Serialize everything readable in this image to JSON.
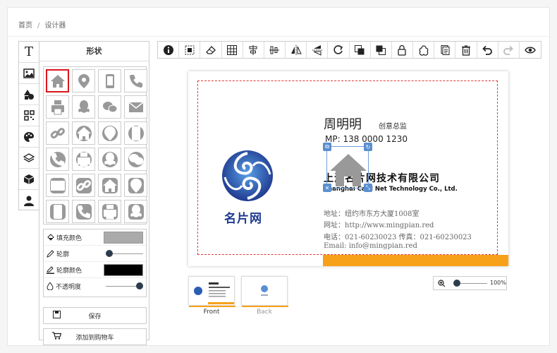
{
  "breadcrumb": {
    "home": "首页",
    "separator": "/",
    "current": "设计器"
  },
  "left_tabs": [
    {
      "icon": "text-icon"
    },
    {
      "icon": "image-icon"
    },
    {
      "icon": "shapes-icon"
    },
    {
      "icon": "qr-code-icon"
    },
    {
      "icon": "palette-icon"
    },
    {
      "icon": "layers-icon"
    },
    {
      "icon": "box-icon"
    },
    {
      "icon": "user-icon"
    }
  ],
  "panel": {
    "title": "形状",
    "shapes": [
      "home-icon",
      "map-pin-icon",
      "tablet-icon",
      "phone-icon",
      "fax-icon",
      "qq-icon",
      "wechat-icon",
      "mail-icon",
      "link-icon",
      "home-circle-icon",
      "map-pin-circle-icon",
      "tablet-circle-icon",
      "phone-circle-icon",
      "fax-circle-icon",
      "qq-circle-icon",
      "wechat-circle-icon",
      "mail-rounded-icon",
      "link-rounded-icon",
      "home-rounded-icon",
      "map-pin-rounded-icon",
      "tablet-rounded-icon",
      "phone-rounded-icon",
      "fax-rounded-icon",
      "qq-rounded-icon"
    ],
    "props": {
      "fill_label": "填充颜色",
      "fill_color": "#aaaaaa",
      "stroke_label": "轮廓",
      "stroke_value": 0,
      "stroke_color_label": "轮廓颜色",
      "stroke_color": "#000000",
      "opacity_label": "不透明度",
      "opacity_value": 1
    },
    "save_label": "保存",
    "cart_label": "添加到购物车"
  },
  "toolbar": [
    "info-icon",
    "select-area-icon",
    "eraser-icon",
    "grid-icon",
    "align-center-horizontal-icon",
    "align-center-vertical-icon",
    "flip-horizontal-icon",
    "flip-vertical-icon",
    "rotate-icon",
    "bring-forward-icon",
    "send-backward-icon",
    "lock-icon",
    "group-icon",
    "duplicate-icon",
    "delete-icon",
    "undo-icon",
    "redo-icon",
    "preview-icon"
  ],
  "card": {
    "name": "周明明",
    "job_title": "创意总监",
    "mobile": "MP: 138 0000 1230",
    "company": "上海名片网技术有限公司",
    "company_en": "Shanghai Card Net Technology Co., Ltd.",
    "address": "地址：纽约市东方大厦1008室",
    "website": "网址：http://www.mingpian.red",
    "phone": "电话：021-60230023  传真：021-60230023",
    "email": "Email: info@mingpian.red",
    "logo_text": "名片网",
    "accent": "#f7a11a",
    "logo_color": "#1f3a8f"
  },
  "thumbnails": [
    {
      "label": "Front",
      "active": true
    },
    {
      "label": "Back",
      "active": false
    }
  ],
  "zoom": {
    "value": "100%",
    "level": 0.0
  }
}
